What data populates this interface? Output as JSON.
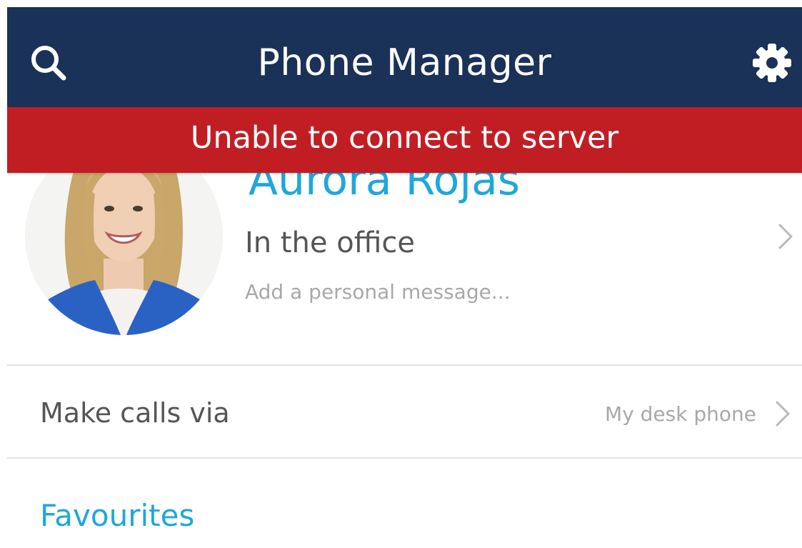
{
  "header": {
    "title": "Phone Manager",
    "search_icon": "search-icon",
    "settings_icon": "gear-icon",
    "background_color": "#1a3158"
  },
  "error_banner": {
    "text": "Unable to connect to server",
    "background_color": "#c11e24"
  },
  "profile": {
    "name": "Aurora Rojas",
    "status": "In the office",
    "message_placeholder": "Add a personal message...",
    "avatar_icon": "avatar",
    "name_color": "#1ea7dc"
  },
  "make_calls": {
    "label": "Make calls via",
    "value": "My desk phone"
  },
  "favourites": {
    "label": "Favourites",
    "color": "#1ea7dc"
  }
}
